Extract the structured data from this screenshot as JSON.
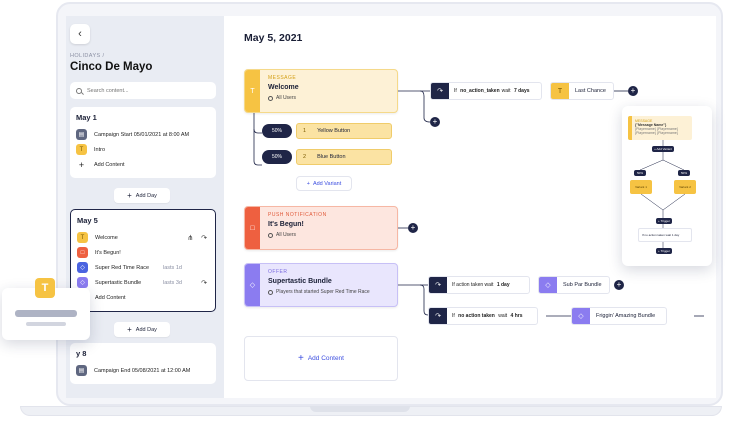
{
  "sidebar": {
    "back_icon": "chevron-left-icon",
    "breadcrumb": "HOLIDAYS /",
    "title": "Cinco De Mayo",
    "search_placeholder": "Search content...",
    "days": [
      {
        "title": "May 1",
        "items": [
          {
            "label": "Campaign Start 05/01/2021 at 8:00 AM",
            "icon": "calendar-icon",
            "color": "#5f6780"
          },
          {
            "label": "Intro",
            "icon": "text-icon",
            "color": "#f6c343"
          },
          {
            "label": "Add Content",
            "icon": "plus-icon"
          }
        ]
      },
      {
        "title": "May 5",
        "items": [
          {
            "label": "Welcome",
            "icon": "text-icon",
            "color": "#f6c343"
          },
          {
            "label": "It's Begun!",
            "icon": "push-icon",
            "color": "#ee6040"
          },
          {
            "label": "Super Red Time Race",
            "icon": "offer-icon",
            "color": "#4a63e0",
            "lasts": "lasts 1d"
          },
          {
            "label": "Supertastic Bundle",
            "icon": "offer-icon",
            "color": "#8b7cf0",
            "lasts": "lasts 3d"
          },
          {
            "label": "Add Content",
            "icon": "plus-icon"
          }
        ]
      },
      {
        "title": "y 8",
        "items": [
          {
            "label": "Campaign End 05/08/2021 at 12:00 AM",
            "icon": "calendar-icon",
            "color": "#5f6780"
          }
        ]
      }
    ],
    "add_day_label": "Add Day"
  },
  "main": {
    "date": "May 5, 2021",
    "message_node": {
      "kicker": "MESSAGE",
      "name": "Welcome",
      "audience": "All Users"
    },
    "variants": [
      {
        "pct": "50%",
        "num": "1",
        "label": "Yellow Button"
      },
      {
        "pct": "50%",
        "num": "2",
        "label": "Blue Button"
      }
    ],
    "add_variant_label": "Add Variant",
    "push_node": {
      "kicker": "PUSH NOTIFICATION",
      "name": "It's Begun!",
      "audience": "All Users"
    },
    "offer_node": {
      "kicker": "OFFER",
      "name": "Supertastic Bundle",
      "audience": "Players that started Super Red Time Race"
    },
    "add_content_label": "Add Content",
    "conditions": [
      {
        "pre": "If",
        "cond": "no_action_taken",
        "mid": "wait",
        "wait": "7 days",
        "target": "Last Chance",
        "target_color": "yellow"
      },
      {
        "pre": "If",
        "cond": "action taken",
        "mid": "wait",
        "wait": "1 day",
        "target": "Sub Par Bundle",
        "target_color": "purple"
      },
      {
        "pre": "If",
        "cond": "no action taken",
        "mid": "wait",
        "wait": "4 hrs",
        "target": "Friggin' Amazing Bundle",
        "target_color": "purple"
      }
    ]
  },
  "mini_flow": {
    "head_kicker": "MESSAGE",
    "head_title": "{\"Message Name\"}",
    "head_text": "{Playername} {Playername} {Playername} {Playername}",
    "add_variant": "+ Add Variant",
    "variant_a": "Variant 1",
    "variant_b": "Variant 2",
    "pct_a": "50%",
    "pct_b": "50%",
    "trigger_a": "+ Trigger",
    "condition_text": "If no action taken wait 1 day",
    "trigger_b": "+ Trigger"
  },
  "template_card": {
    "badge": "T"
  },
  "colors": {
    "message": "#f6c343",
    "push": "#ee6040",
    "offer": "#8b7cf0",
    "navy": "#1f2547",
    "link": "#3d4fe0"
  }
}
